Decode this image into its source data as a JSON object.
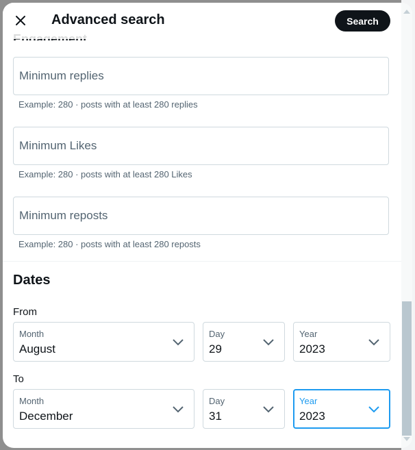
{
  "header": {
    "title": "Advanced search",
    "close_icon": "close-icon",
    "search_label": "Search"
  },
  "cut_off_heading": "Engagement",
  "engagement": {
    "fields": [
      {
        "placeholder": "Minimum replies",
        "value": "",
        "hint": "Example: 280 · posts with at least 280 replies"
      },
      {
        "placeholder": "Minimum Likes",
        "value": "",
        "hint": "Example: 280 · posts with at least 280 Likes"
      },
      {
        "placeholder": "Minimum reposts",
        "value": "",
        "hint": "Example: 280 · posts with at least 280 reposts"
      }
    ]
  },
  "dates": {
    "heading": "Dates",
    "from": {
      "label": "From",
      "month": {
        "label": "Month",
        "value": "August"
      },
      "day": {
        "label": "Day",
        "value": "29"
      },
      "year": {
        "label": "Year",
        "value": "2023"
      }
    },
    "to": {
      "label": "To",
      "month": {
        "label": "Month",
        "value": "December"
      },
      "day": {
        "label": "Day",
        "value": "31"
      },
      "year": {
        "label": "Year",
        "value": "2023",
        "focused": true
      }
    }
  },
  "colors": {
    "accent": "#1d9bf0",
    "primary_text": "#0f1419",
    "secondary_text": "#536471",
    "border": "#cfd9de",
    "button_bg": "#0f1419"
  }
}
